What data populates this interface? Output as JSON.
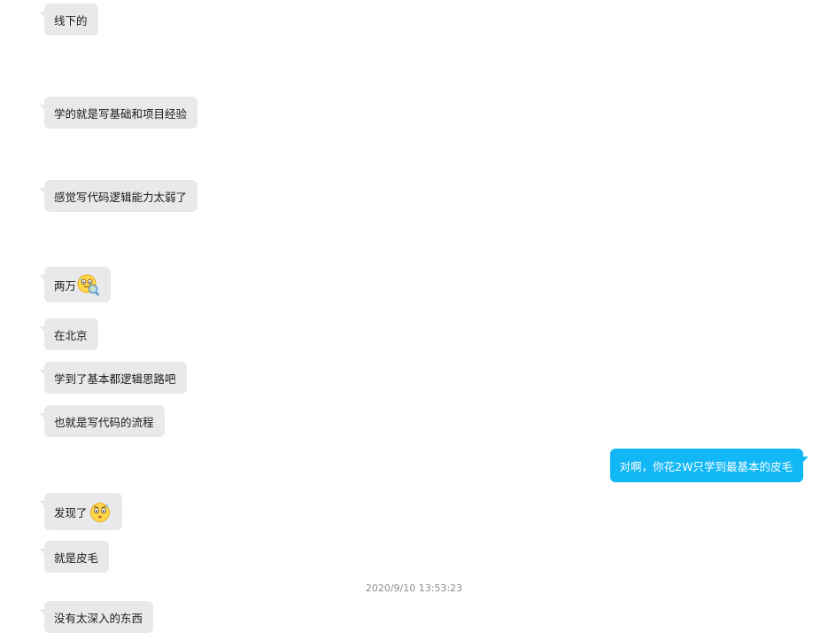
{
  "chat": {
    "messages": [
      {
        "side": "left",
        "text": "线下的"
      },
      {
        "side": "left",
        "text": "学的就是写基础和项目经验"
      },
      {
        "side": "left",
        "text": "感觉写代码逻辑能力太弱了"
      },
      {
        "side": "left",
        "text": "两万",
        "emoji": "sweating-magnifier-emoji"
      },
      {
        "side": "left",
        "text": "在北京"
      },
      {
        "side": "left",
        "text": "学到了基本都逻辑思路吧"
      },
      {
        "side": "left",
        "text": "也就是写代码的流程"
      },
      {
        "side": "right",
        "text": "对啊，你花2W只学到最基本的皮毛"
      },
      {
        "side": "left",
        "text": "发现了",
        "emoji": "sweating-face-emoji"
      },
      {
        "side": "left",
        "text": "就是皮毛"
      },
      {
        "side": "left",
        "text": "没有太深入的东西"
      }
    ],
    "timestamp": "2020/9/10 13:53:23"
  },
  "colors": {
    "incoming_bubble": "#e9e9eb",
    "outgoing_bubble": "#12b7f5",
    "timestamp_text": "#8c8c8c"
  }
}
